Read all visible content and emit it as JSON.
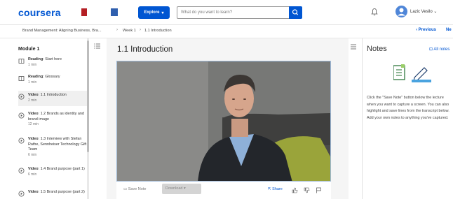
{
  "header": {
    "logo": "coursera",
    "explore": "Explore",
    "search_placeholder": "What do you want to learn?",
    "user_name": "Lazic Vesilo"
  },
  "breadcrumb": {
    "course": "Brand Management: Aligning Business, Bra...",
    "week": "Week 1",
    "lesson": "1.1 Introduction",
    "previous": "Previous",
    "next": "Ne"
  },
  "sidebar": {
    "module": "Module 1",
    "items": [
      {
        "type": "Reading",
        "title": "Start here",
        "meta": "1 min"
      },
      {
        "type": "Reading",
        "title": "Glossary",
        "meta": "1 min"
      },
      {
        "type": "Video",
        "title": "1.1 Introduction",
        "meta": "2 min"
      },
      {
        "type": "Video",
        "title": "1.2 Brands as identity and brand image",
        "meta": "12 min"
      },
      {
        "type": "Video",
        "title": "1.3 Interview with Stefan Rathe, Sennheiser Technology Gift Team",
        "meta": "6 min"
      },
      {
        "type": "Video",
        "title": "1.4 Brand purpose (part 1)",
        "meta": "6 min"
      },
      {
        "type": "Video",
        "title": "1.5 Brand purpose (part 2)",
        "meta": ""
      }
    ]
  },
  "main": {
    "title": "1.1 Introduction",
    "save_note": "Save Note",
    "download": "Download",
    "share": "Share"
  },
  "notes": {
    "title": "Notes",
    "all_notes": "All notes",
    "body": "Click the \"Save Note\" button below the lecture when you want to capture a screen. You can also highlight and save lines from the transcript below. Add your own notes to anything you've captured."
  },
  "colors": {
    "brand": "#0056d2"
  }
}
